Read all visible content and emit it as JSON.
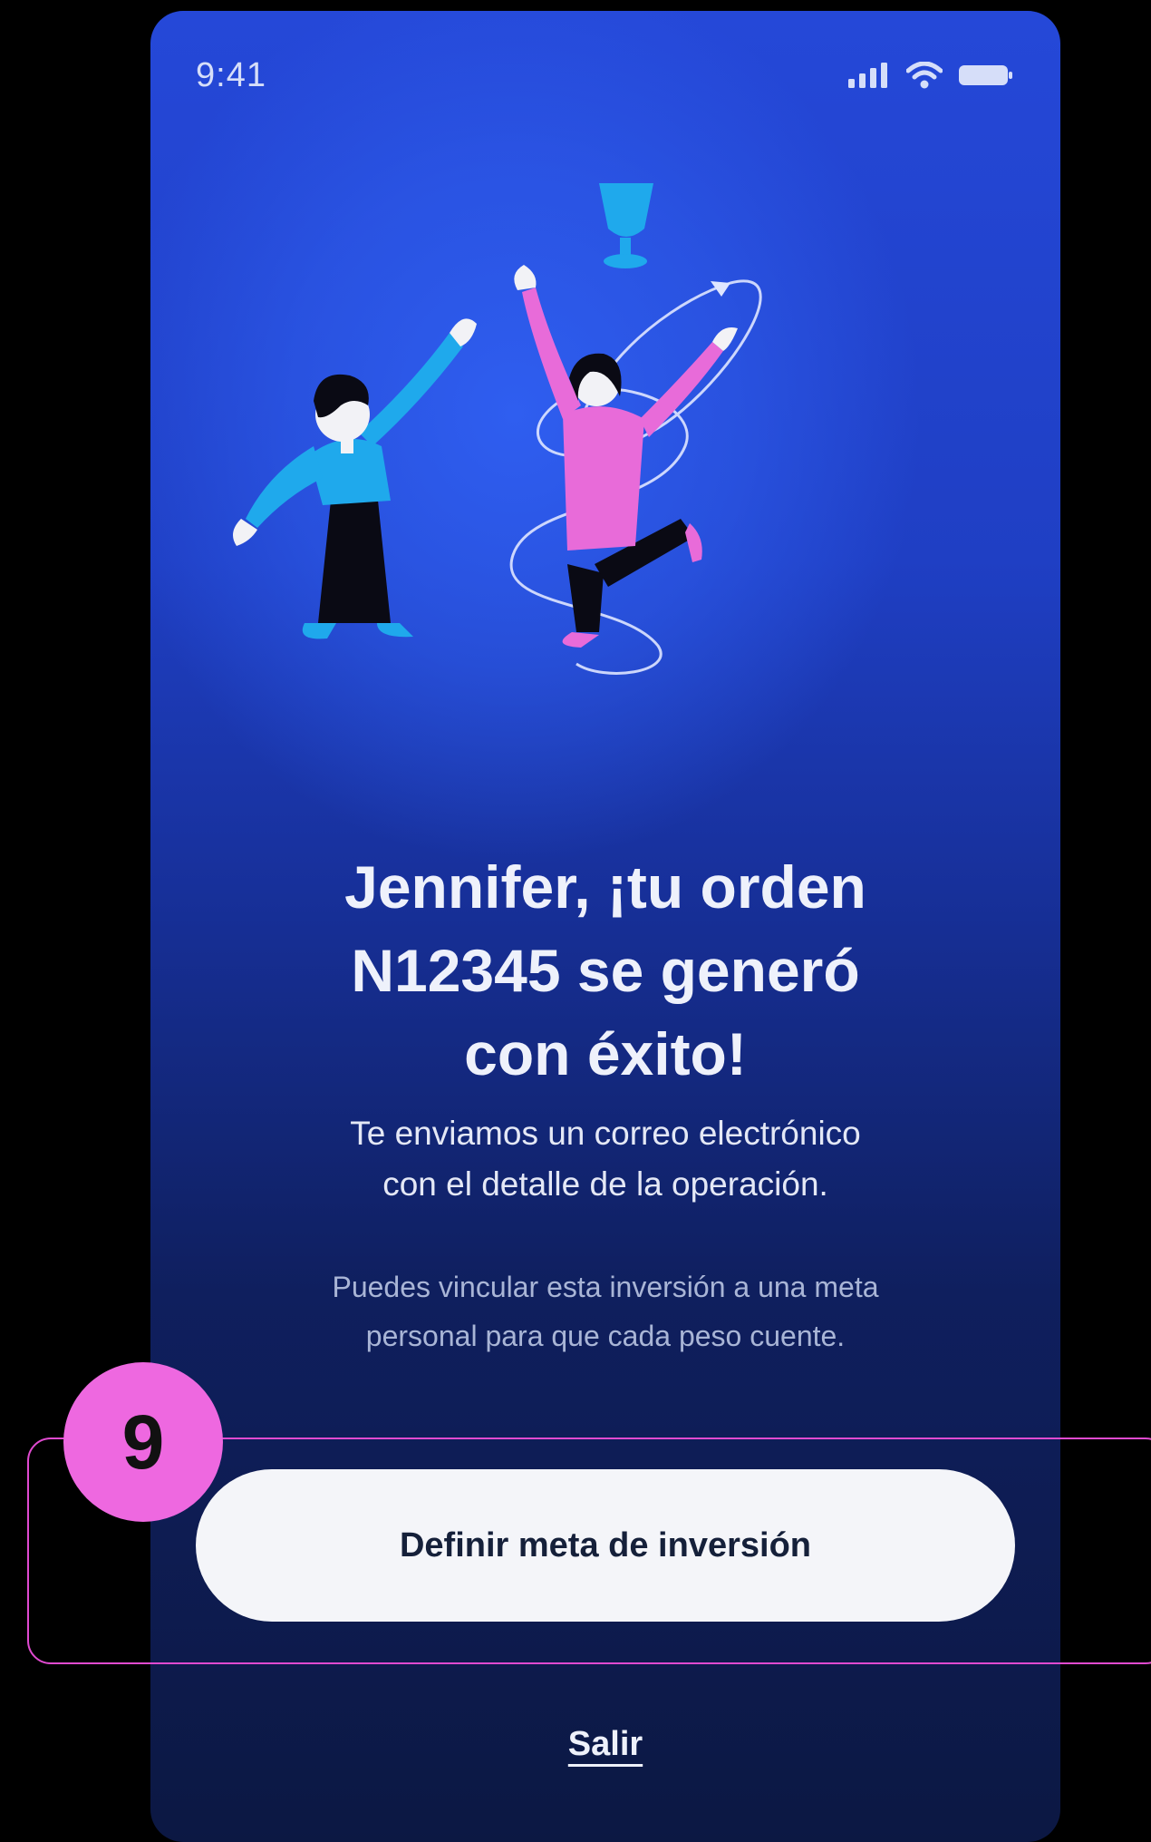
{
  "status_bar": {
    "time": "9:41",
    "icons": [
      "cellular-signal-icon",
      "wifi-icon",
      "battery-icon"
    ]
  },
  "illustration": {
    "name": "celebration-illustration",
    "colors": {
      "man_shirt": "#1fa9ec",
      "woman_shirt": "#e86bd9",
      "pants": "#0a0a14",
      "trophy": "#1fa9ec"
    }
  },
  "heading": {
    "line1": "Jennifer, ¡tu orden",
    "line2": "N12345 se generó",
    "line3": "con éxito!"
  },
  "message": {
    "line1": "Te enviamos un correo electrónico",
    "line2": "con el detalle de la operación."
  },
  "hint": {
    "line1": "Puedes vincular esta inversión a una meta",
    "line2": "personal para que cada peso cuente."
  },
  "primary_button": {
    "label": "Definir meta de inversión"
  },
  "exit_link": {
    "label": "Salir"
  },
  "annotation": {
    "number": "9",
    "accent": "#ee68e0"
  },
  "colors": {
    "background_top": "#2548d8",
    "background_bottom": "#0c1843",
    "button_bg": "#f4f5f9"
  }
}
